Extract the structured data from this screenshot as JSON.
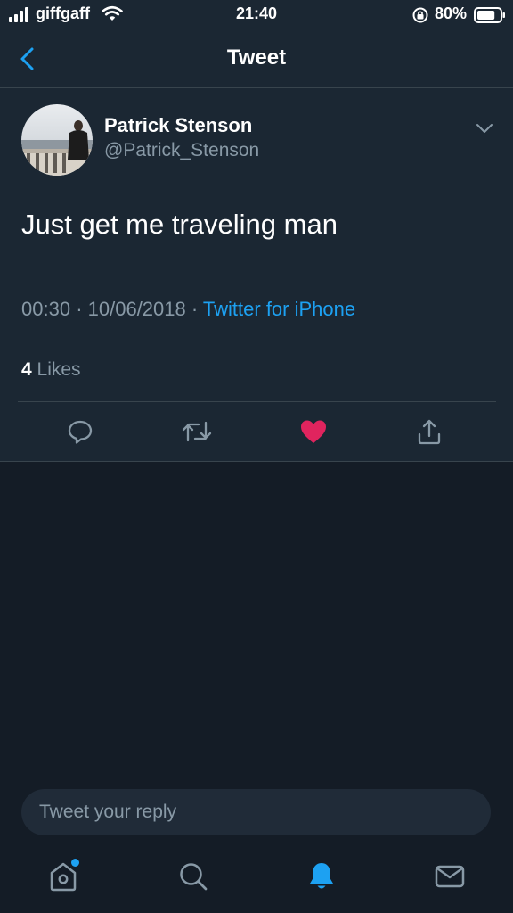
{
  "status_bar": {
    "carrier": "giffgaff",
    "time": "21:40",
    "battery_percent": "80%",
    "battery_level": 0.8,
    "icons": [
      "signal-icon",
      "wifi-icon",
      "rotation-lock-icon",
      "battery-icon"
    ]
  },
  "nav": {
    "title": "Tweet",
    "back_icon": "chevron-left-icon"
  },
  "tweet": {
    "author_name": "Patrick Stenson",
    "author_handle": "@Patrick_Stenson",
    "text": "Just get me traveling man",
    "time": "00:30",
    "separator": "·",
    "date": "10/06/2018",
    "source": "Twitter for iPhone",
    "likes_count": "4",
    "likes_label": "Likes",
    "liked": true,
    "actions": [
      "reply-icon",
      "retweet-icon",
      "like-icon",
      "share-icon"
    ]
  },
  "reply": {
    "placeholder": "Tweet your reply"
  },
  "tab_bar": {
    "items": [
      "home-icon",
      "search-icon",
      "notifications-icon",
      "messages-icon"
    ],
    "active": "notifications-icon"
  },
  "colors": {
    "accent": "#1da1f2",
    "like": "#e0245e",
    "background": "#1b2733",
    "background_dark": "#141c26",
    "secondary_text": "#8899a6",
    "divider": "#38444d"
  }
}
